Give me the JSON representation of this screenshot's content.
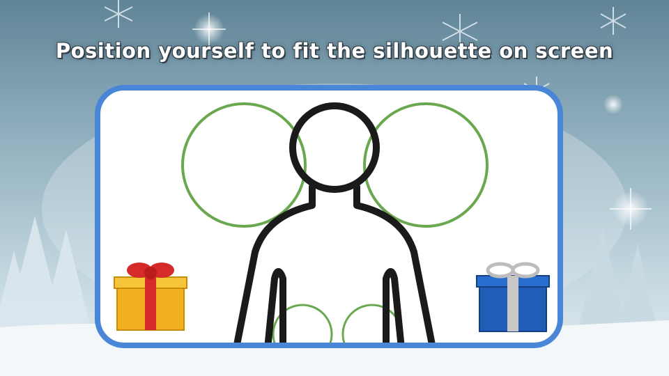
{
  "instruction": "Position yourself to fit the silhouette on screen",
  "icons": {
    "silhouette": "person-silhouette-icon",
    "left_target": "left-hand-target-circle",
    "right_target": "right-hand-target-circle",
    "gift_left": "gold-gift-box-icon",
    "gift_right": "blue-gift-box-icon"
  },
  "colors": {
    "frame_border": "#4a86d8",
    "target_ring": "#6aa84f",
    "silhouette_stroke": "#1a1a1a"
  }
}
